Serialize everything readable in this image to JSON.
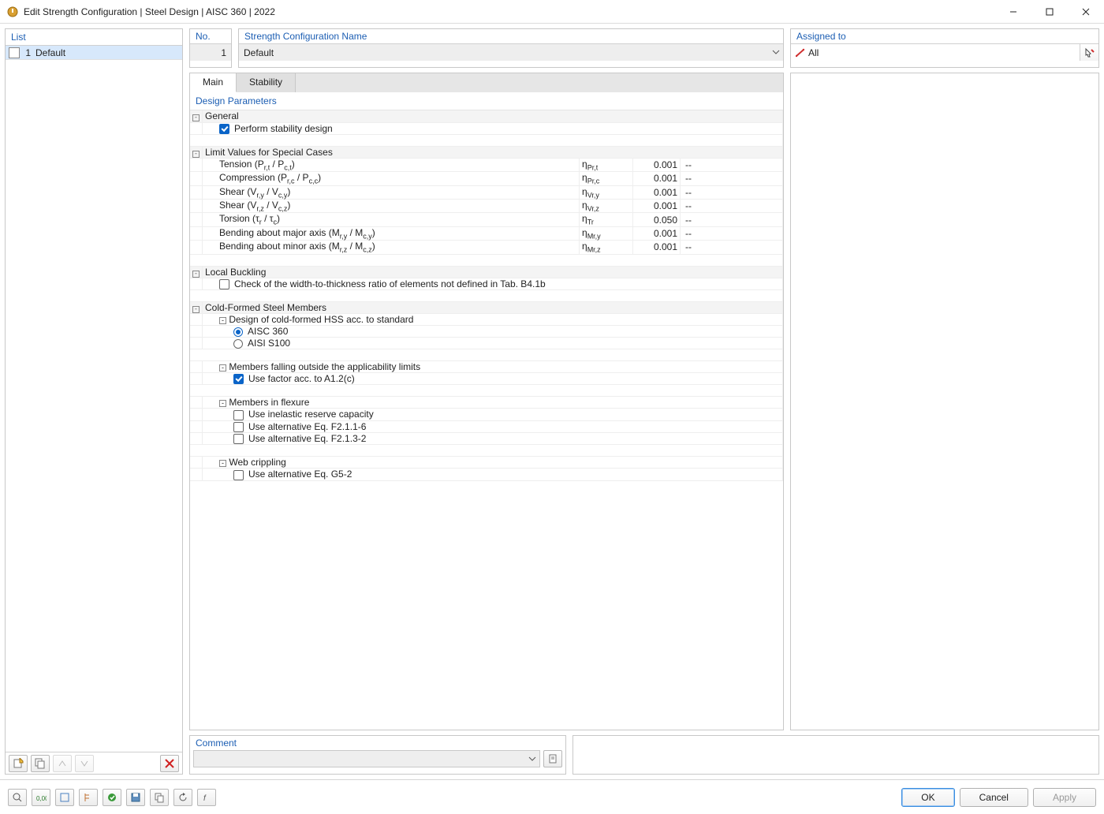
{
  "window": {
    "title": "Edit Strength Configuration | Steel Design | AISC 360 | 2022"
  },
  "left": {
    "header": "List",
    "item_no": "1",
    "item_name": "Default"
  },
  "top": {
    "no_label": "No.",
    "no_value": "1",
    "name_label": "Strength Configuration Name",
    "name_value": "Default",
    "assigned_label": "Assigned to",
    "assigned_value": "All"
  },
  "tabs": {
    "main": "Main",
    "stability": "Stability"
  },
  "section": {
    "title": "Design Parameters"
  },
  "groups": {
    "general": "General",
    "perform_stability": "Perform stability design",
    "limit_values": "Limit Values for Special Cases",
    "local_buckling": "Local Buckling",
    "local_buckling_check": "Check of the width-to-thickness ratio of elements not defined in Tab. B4.1b",
    "cold_formed": "Cold-Formed Steel Members",
    "design_hss": "Design of cold-formed HSS acc. to standard",
    "aisc360": "AISC 360",
    "aisi_s100": "AISI S100",
    "outside_limits": "Members falling outside the applicability limits",
    "use_factor": "Use factor acc. to A1.2(c)",
    "flexure": "Members in flexure",
    "inelastic": "Use inelastic reserve capacity",
    "alt_f2116": "Use alternative Eq. F2.1.1-6",
    "alt_f2132": "Use alternative Eq. F2.1.3-2",
    "web_crippling": "Web crippling",
    "alt_g52": "Use alternative Eq. G5-2"
  },
  "limits": [
    {
      "label": "Tension (P",
      "sub1": "r,t",
      "mid": " / P",
      "sub2": "c,t",
      "end": ")",
      "sym": "η",
      "ssub": "Pr,t",
      "val": "0.001",
      "unit": "--"
    },
    {
      "label": "Compression (P",
      "sub1": "r,c",
      "mid": " / P",
      "sub2": "c,c",
      "end": ")",
      "sym": "η",
      "ssub": "Pr,c",
      "val": "0.001",
      "unit": "--"
    },
    {
      "label": "Shear (V",
      "sub1": "r,y",
      "mid": " / V",
      "sub2": "c,y",
      "end": ")",
      "sym": "η",
      "ssub": "Vr,y",
      "val": "0.001",
      "unit": "--"
    },
    {
      "label": "Shear (V",
      "sub1": "r,z",
      "mid": " / V",
      "sub2": "c,z",
      "end": ")",
      "sym": "η",
      "ssub": "Vr,z",
      "val": "0.001",
      "unit": "--"
    },
    {
      "label": "Torsion (τ",
      "sub1": "r",
      "mid": " / τ",
      "sub2": "c",
      "end": ")",
      "sym": "η",
      "ssub": "Tr",
      "val": "0.050",
      "unit": "--"
    },
    {
      "label": "Bending about major axis (M",
      "sub1": "r,y",
      "mid": " / M",
      "sub2": "c,y",
      "end": ")",
      "sym": "η",
      "ssub": "Mr,y",
      "val": "0.001",
      "unit": "--"
    },
    {
      "label": "Bending about minor axis (M",
      "sub1": "r,z",
      "mid": " / M",
      "sub2": "c,z",
      "end": ")",
      "sym": "η",
      "ssub": "Mr,z",
      "val": "0.001",
      "unit": "--"
    }
  ],
  "comment": {
    "label": "Comment"
  },
  "buttons": {
    "ok": "OK",
    "cancel": "Cancel",
    "apply": "Apply"
  }
}
